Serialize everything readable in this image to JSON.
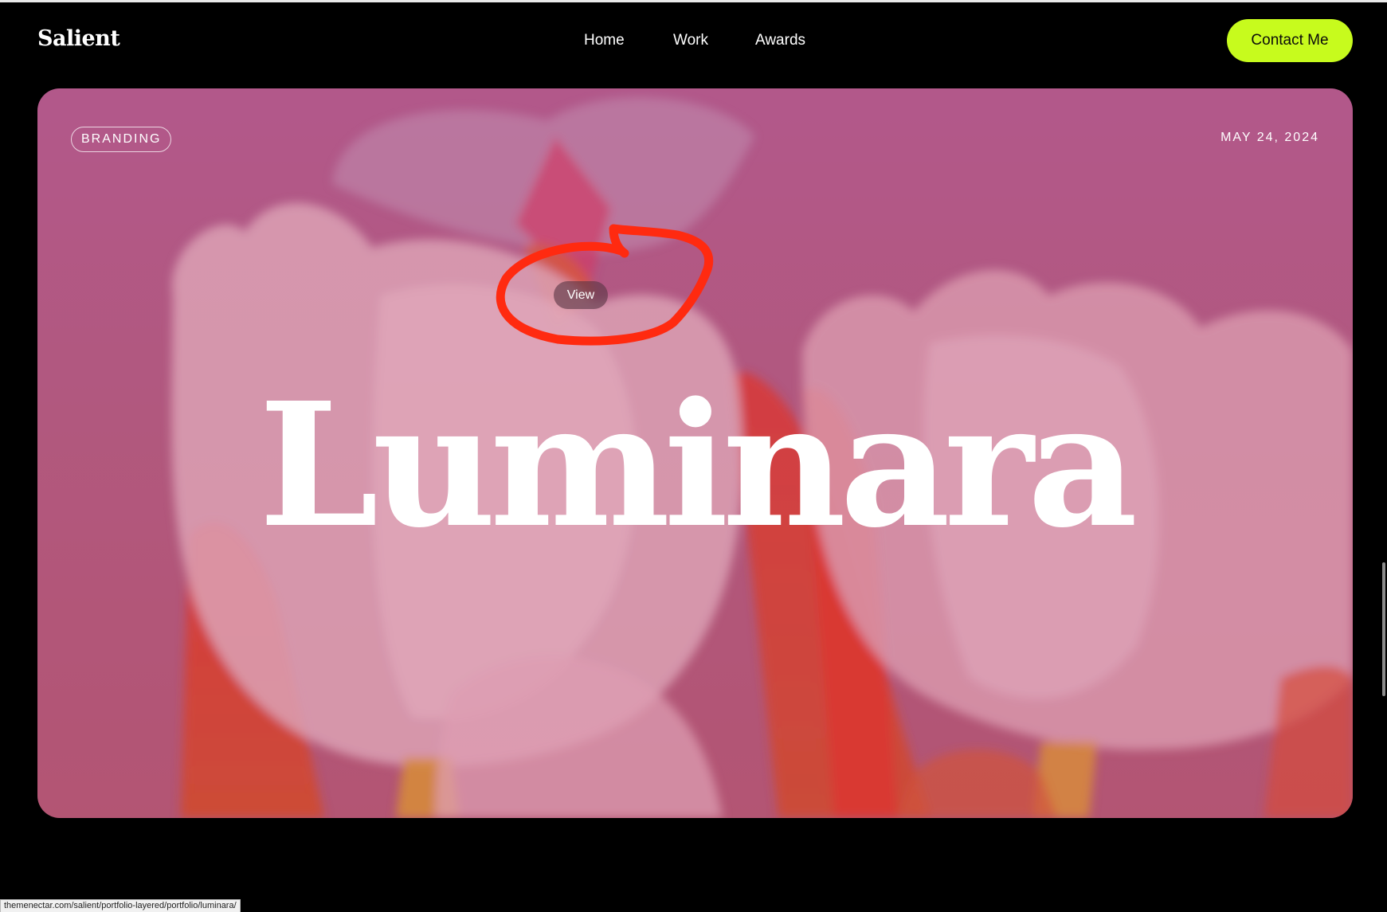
{
  "header": {
    "logo": "Salient",
    "nav": [
      "Home",
      "Work",
      "Awards"
    ],
    "contact_label": "Contact Me"
  },
  "hero": {
    "category": "BRANDING",
    "date": "MAY 24, 2024",
    "title": "Luminara",
    "view_label": "View"
  },
  "status_url": "themenectar.com/salient/portfolio-layered/portfolio/luminara/",
  "colors": {
    "accent": "#c7fb1d",
    "card_pink": "#b25a8e",
    "annotation_red": "#ff2a10"
  }
}
